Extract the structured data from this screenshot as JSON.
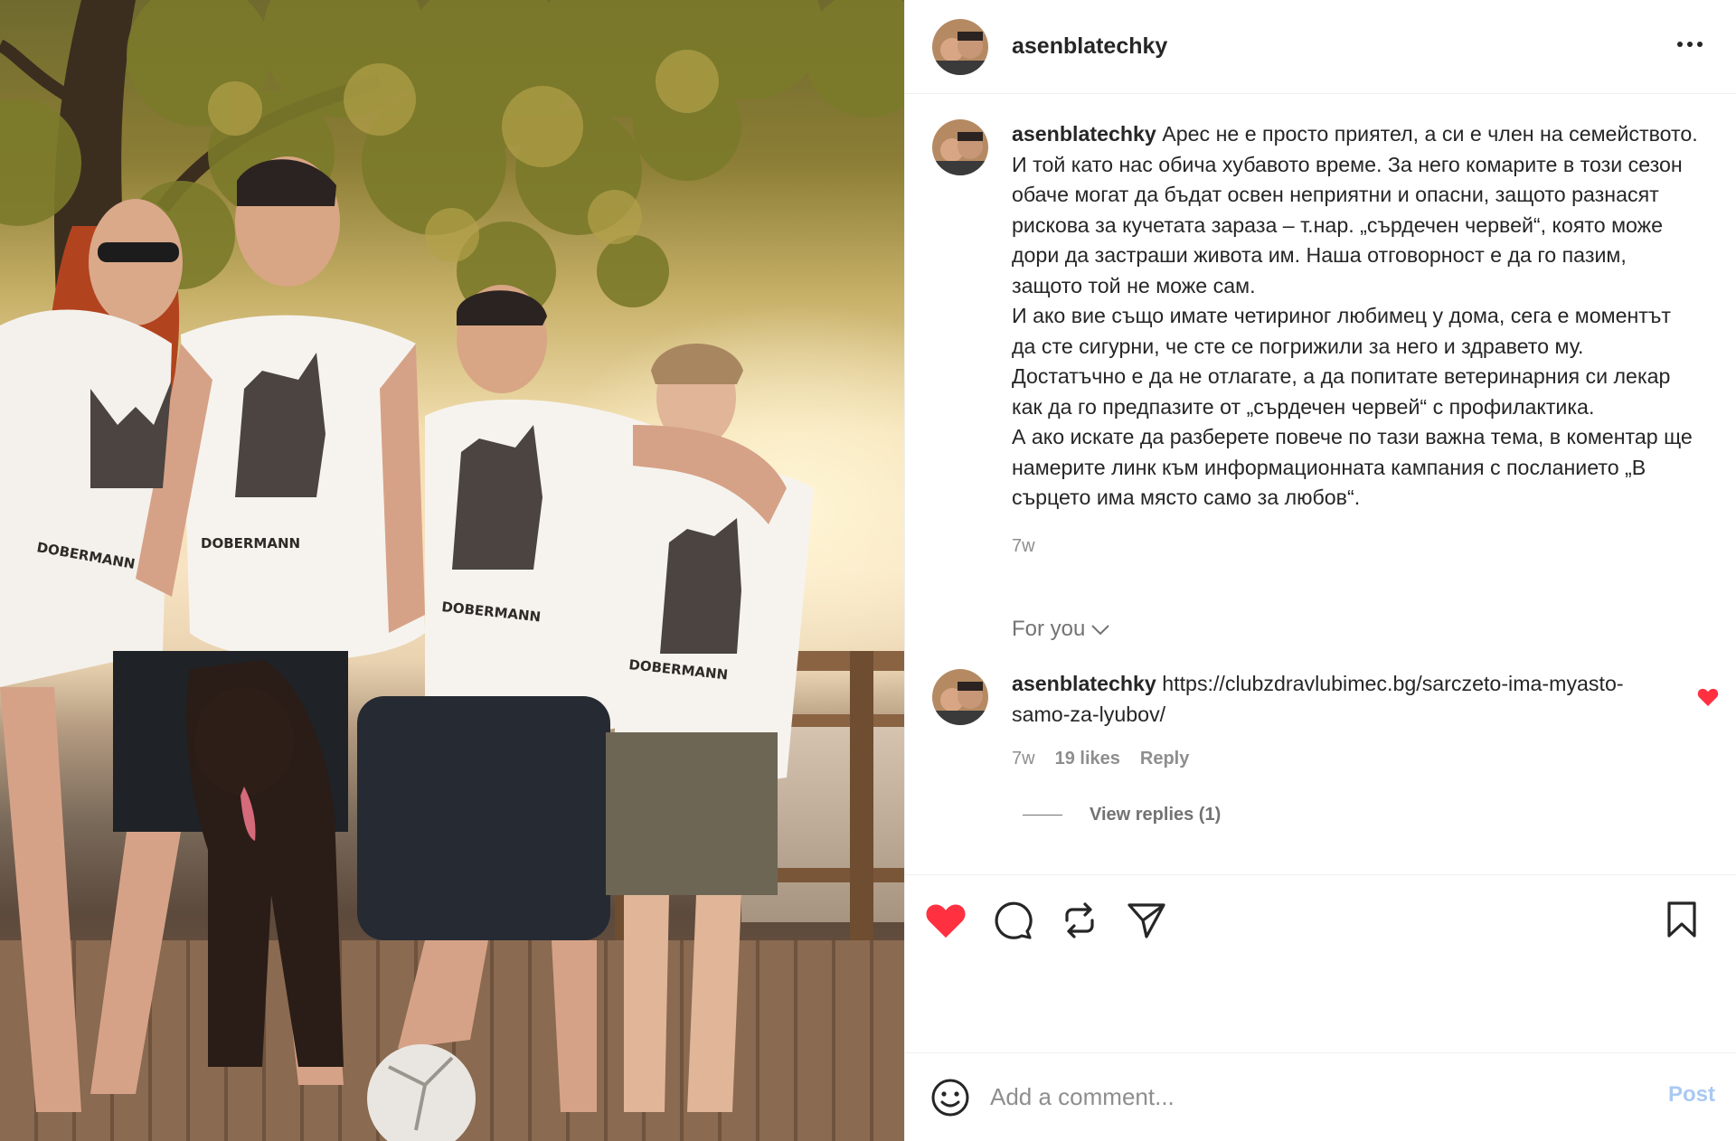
{
  "post": {
    "username": "asenblatechky"
  },
  "caption": {
    "username": "asenblatechky",
    "text": "Арес не е просто приятел, а си е член на семейството. И той като нас обича хубавото време. За него комарите в този сезон обаче могат да бъдат освен неприятни и опасни, защото разнасят рискова за кучетата зараза – т.нар. „сърдечен червей“, която може дори да застраши живота им. Наша отговорност е да го пазим, защото той не може сам.\nИ ако вие също имате четириног любимец у дома, сега е моментът да сте сигурни, че сте се погрижили за него и здравето му. Достатъчно е да не отлагате, а да попитате ветеринарния си лекар как да го предпазите от „сърдечен червей“ с профилактика.\nА ако искате да разберете повече по тази важна тема, в коментар ще намерите линк към информационната кампания с посланието „В сърцето има място само за любов“.",
    "timestamp": "7w"
  },
  "sort": {
    "label": "For you"
  },
  "comment": {
    "username": "asenblatechky",
    "link": "https://clubzdravlubimec.bg/sarczeto-ima-myasto-samo-za-lyubov/",
    "timestamp": "7w",
    "likes": "19 likes",
    "reply_label": "Reply",
    "liked": true
  },
  "view_replies": {
    "label": "View replies (1)"
  },
  "actions": {
    "liked": true,
    "like_color": "#ff3040",
    "icons": [
      "heart-icon",
      "comment-icon",
      "repost-icon",
      "share-icon",
      "bookmark-icon"
    ]
  },
  "add_comment": {
    "placeholder": "Add a comment...",
    "post_label": "Post",
    "post_color": "#a9c9f5"
  },
  "photo": {
    "shirt_text": "DOBERMANN"
  }
}
